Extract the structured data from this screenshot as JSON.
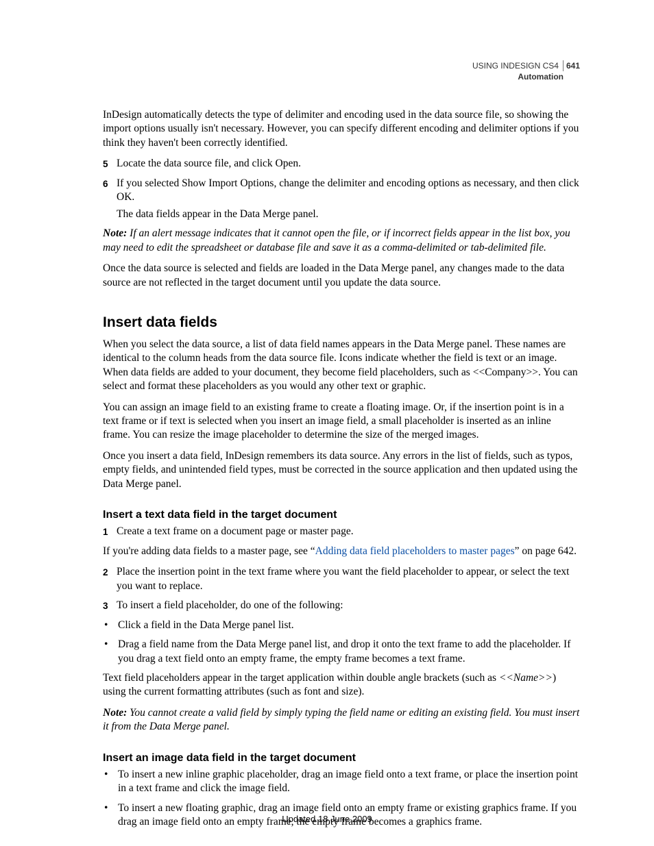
{
  "header": {
    "book": "USING INDESIGN CS4",
    "page": "641",
    "section": "Automation"
  },
  "intro": {
    "p1": "InDesign automatically detects the type of delimiter and encoding used in the data source file, so showing the import options usually isn't necessary. However, you can specify different encoding and delimiter options if you think they haven't been correctly identified.",
    "step5num": "5",
    "step5": "Locate the data source file, and click Open.",
    "step6num": "6",
    "step6a": "If you selected Show Import Options, change the delimiter and encoding options as necessary, and then click OK.",
    "step6b": "The data fields appear in the Data Merge panel.",
    "noteLabel": "Note:",
    "note": " If an alert message indicates that it cannot open the file, or if incorrect fields appear in the list box, you may need to edit the spreadsheet or database file and save it as a comma-delimited or tab-delimited file.",
    "p2": "Once the data source is selected and fields are loaded in the Data Merge panel, any changes made to the data source are not reflected in the target document until you update the data source."
  },
  "h2": "Insert data fields",
  "body": {
    "p1": "When you select the data source, a list of data field names appears in the Data Merge panel. These names are identical to the column heads from the data source file. Icons indicate whether the field is text or an image. When data fields are added to your document, they become field placeholders, such as <<Company>>. You can select and format these placeholders as you would any other text or graphic.",
    "p2": "You can assign an image field to an existing frame to create a floating image. Or, if the insertion point is in a text frame or if text is selected when you insert an image field, a small placeholder is inserted as an inline frame. You can resize the image placeholder to determine the size of the merged images.",
    "p3": "Once you insert a data field, InDesign remembers its data source. Any errors in the list of fields, such as typos, empty fields, and unintended field types, must be corrected in the source application and then updated using the Data Merge panel."
  },
  "h3a": "Insert a text data field in the target document",
  "text": {
    "s1num": "1",
    "s1": "Create a text frame on a document page or master page.",
    "masterA": "If you're adding data fields to a master page, see “",
    "masterLink": "Adding data field placeholders to master pages",
    "masterB": "” on page 642.",
    "s2num": "2",
    "s2": "Place the insertion point in the text frame where you want the field placeholder to appear, or select the text you want to replace.",
    "s3num": "3",
    "s3": "To insert a field placeholder, do one of the following:",
    "b1": "Click a field in the Data Merge panel list.",
    "b2": "Drag a field name from the Data Merge panel list, and drop it onto the text frame to add the placeholder. If you drag a text field onto an empty frame, the empty frame becomes a text frame.",
    "p4a": "Text field placeholders appear in the target application within double angle brackets (such as ",
    "p4i": "<<Name>>",
    "p4b": ") using the current formatting attributes (such as font and size).",
    "note2Label": "Note:",
    "note2": " You cannot create a valid field by simply typing the field name or editing an existing field. You must insert it from the Data Merge panel."
  },
  "h3b": "Insert an image data field in the target document",
  "image": {
    "b1": "To insert a new inline graphic placeholder, drag an image field onto a text frame, or place the insertion point in a text frame and click the image field.",
    "b2": "To insert a new floating graphic, drag an image field onto an empty frame or existing graphics frame. If you drag an image field onto an empty frame, the empty frame becomes a graphics frame."
  },
  "footer": "Updated 18 June 2009"
}
